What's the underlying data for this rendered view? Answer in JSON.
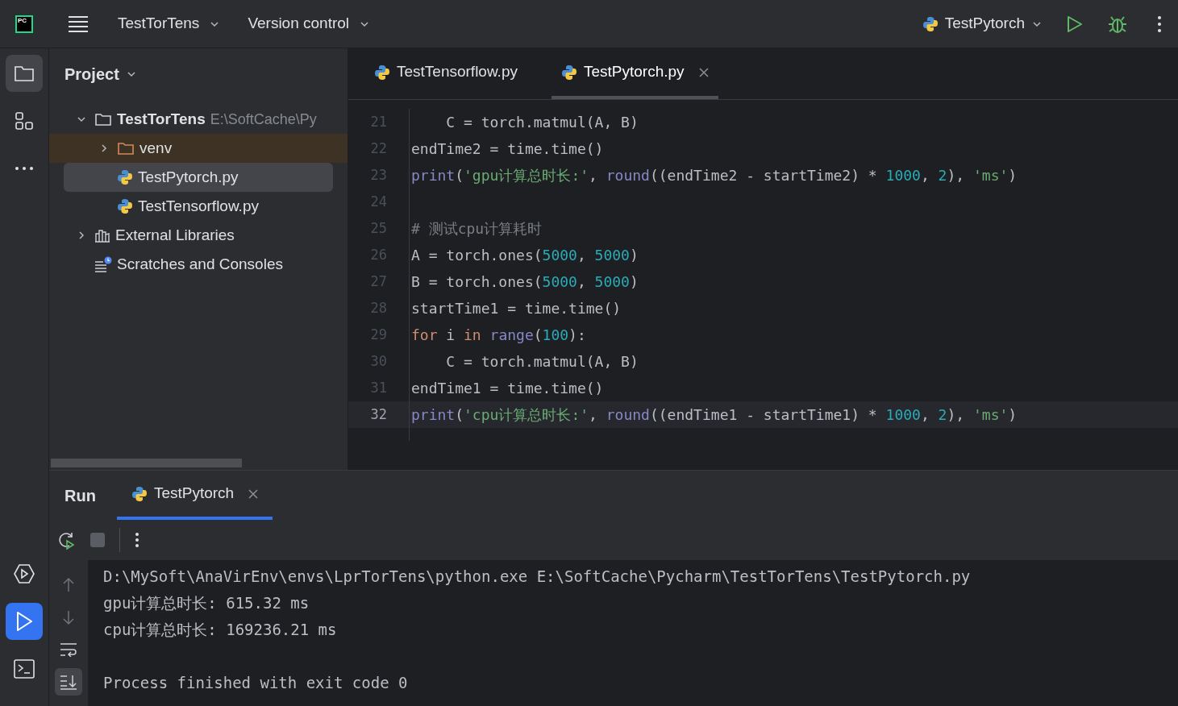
{
  "logo": "PC",
  "toolbar": {
    "project": "TestTorTens",
    "vcs": "Version control",
    "run_config": "TestPytorch"
  },
  "tool_strip": [
    {
      "kind": "project",
      "selected": true
    },
    {
      "kind": "structure",
      "selected": false
    },
    {
      "kind": "more",
      "selected": false
    }
  ],
  "tool_strip_bottom": [
    {
      "kind": "services",
      "selected": false
    },
    {
      "kind": "run",
      "selected": true
    },
    {
      "kind": "terminal",
      "selected": false
    }
  ],
  "project_panel": {
    "title": "Project",
    "tree": [
      {
        "label": "TestTorTens",
        "path": "E:\\SoftCache\\Py",
        "kind": "folder",
        "expanded": true,
        "selected": false,
        "children": [
          {
            "label": "venv",
            "kind": "excluded_folder",
            "expanded": false,
            "selected": false
          },
          {
            "label": "TestPytorch.py",
            "kind": "python_file",
            "selected": true
          },
          {
            "label": "TestTensorflow.py",
            "kind": "python_file",
            "selected": false
          }
        ]
      },
      {
        "label": "External Libraries",
        "kind": "libraries",
        "expanded": false,
        "selected": false
      },
      {
        "label": "Scratches and Consoles",
        "kind": "scratches",
        "selected": false
      }
    ]
  },
  "editor": {
    "tabs": [
      {
        "label": "TestTensorflow.py",
        "selected": false
      },
      {
        "label": "TestPytorch.py",
        "selected": true
      }
    ],
    "lines": [
      {
        "number": "21",
        "current": false,
        "tokens": [
          {
            "text": "    C = torch.matmul(A, B)",
            "kind": "plain"
          }
        ]
      },
      {
        "number": "22",
        "current": false,
        "tokens": [
          {
            "text": "endTime2 = time.time()",
            "kind": "plain"
          }
        ]
      },
      {
        "number": "23",
        "current": false,
        "tokens": [
          {
            "text": "print",
            "kind": "builtin"
          },
          {
            "text": "(",
            "kind": "plain"
          },
          {
            "text": "'gpu计算总时长:'",
            "kind": "string"
          },
          {
            "text": ", ",
            "kind": "plain"
          },
          {
            "text": "round",
            "kind": "builtin"
          },
          {
            "text": "((endTime2 - startTime2) * ",
            "kind": "plain"
          },
          {
            "text": "1000",
            "kind": "number"
          },
          {
            "text": ", ",
            "kind": "plain"
          },
          {
            "text": "2",
            "kind": "number"
          },
          {
            "text": "), ",
            "kind": "plain"
          },
          {
            "text": "'ms'",
            "kind": "string"
          },
          {
            "text": ")",
            "kind": "plain"
          }
        ]
      },
      {
        "number": "24",
        "current": false
      },
      {
        "number": "25",
        "current": false,
        "tokens": [
          {
            "text": "# 测试cpu计算耗时",
            "kind": "comment"
          }
        ]
      },
      {
        "number": "26",
        "current": false,
        "tokens": [
          {
            "text": "A = torch.ones(",
            "kind": "plain"
          },
          {
            "text": "5000",
            "kind": "number"
          },
          {
            "text": ", ",
            "kind": "plain"
          },
          {
            "text": "5000",
            "kind": "number"
          },
          {
            "text": ")",
            "kind": "plain"
          }
        ]
      },
      {
        "number": "27",
        "current": false,
        "tokens": [
          {
            "text": "B = torch.ones(",
            "kind": "plain"
          },
          {
            "text": "5000",
            "kind": "number"
          },
          {
            "text": ", ",
            "kind": "plain"
          },
          {
            "text": "5000",
            "kind": "number"
          },
          {
            "text": ")",
            "kind": "plain"
          }
        ]
      },
      {
        "number": "28",
        "current": false,
        "tokens": [
          {
            "text": "startTime1 = time.time()",
            "kind": "plain"
          }
        ]
      },
      {
        "number": "29",
        "current": false,
        "tokens": [
          {
            "text": "for",
            "kind": "keyword"
          },
          {
            "text": " i ",
            "kind": "plain"
          },
          {
            "text": "in ",
            "kind": "keyword"
          },
          {
            "text": "range",
            "kind": "builtin"
          },
          {
            "text": "(",
            "kind": "plain"
          },
          {
            "text": "100",
            "kind": "number"
          },
          {
            "text": "):",
            "kind": "plain"
          }
        ]
      },
      {
        "number": "30",
        "current": false,
        "tokens": [
          {
            "text": "    C = torch.matmul(A, B)",
            "kind": "plain"
          }
        ]
      },
      {
        "number": "31",
        "current": false,
        "tokens": [
          {
            "text": "endTime1 = time.time()",
            "kind": "plain"
          }
        ]
      },
      {
        "number": "32",
        "current": true,
        "tokens": [
          {
            "text": "print",
            "kind": "builtin"
          },
          {
            "text": "(",
            "kind": "plain"
          },
          {
            "text": "'cpu计算总时长:'",
            "kind": "string"
          },
          {
            "text": ", ",
            "kind": "plain"
          },
          {
            "text": "round",
            "kind": "builtin"
          },
          {
            "text": "((endTime1 - startTime1) * ",
            "kind": "plain"
          },
          {
            "text": "1000",
            "kind": "number"
          },
          {
            "text": ", ",
            "kind": "plain"
          },
          {
            "text": "2",
            "kind": "number"
          },
          {
            "text": "), ",
            "kind": "plain"
          },
          {
            "text": "'ms'",
            "kind": "string"
          },
          {
            "text": ")",
            "kind": "plain"
          }
        ]
      }
    ]
  },
  "run_panel": {
    "title": "Run",
    "tabs": [
      {
        "label": "TestPytorch",
        "selected": true
      }
    ],
    "side_tools": [
      {
        "kind": "up",
        "selected": false
      },
      {
        "kind": "down",
        "selected": false
      },
      {
        "kind": "wrap",
        "selected": false
      },
      {
        "kind": "scroll_end",
        "selected": true
      }
    ],
    "console": [
      {
        "text": "D:\\MySoft\\AnaVirEnv\\envs\\LprTorTens\\python.exe E:\\SoftCache\\Pycharm\\TestTorTens\\TestPytorch.py",
        "kind": "output"
      },
      {
        "text": "gpu计算总时长: 615.32 ms",
        "kind": "output"
      },
      {
        "text": "cpu计算总时长: 169236.21 ms",
        "kind": "output"
      },
      {
        "text": "Process finished with exit code 0",
        "kind": "exit_status"
      }
    ]
  }
}
